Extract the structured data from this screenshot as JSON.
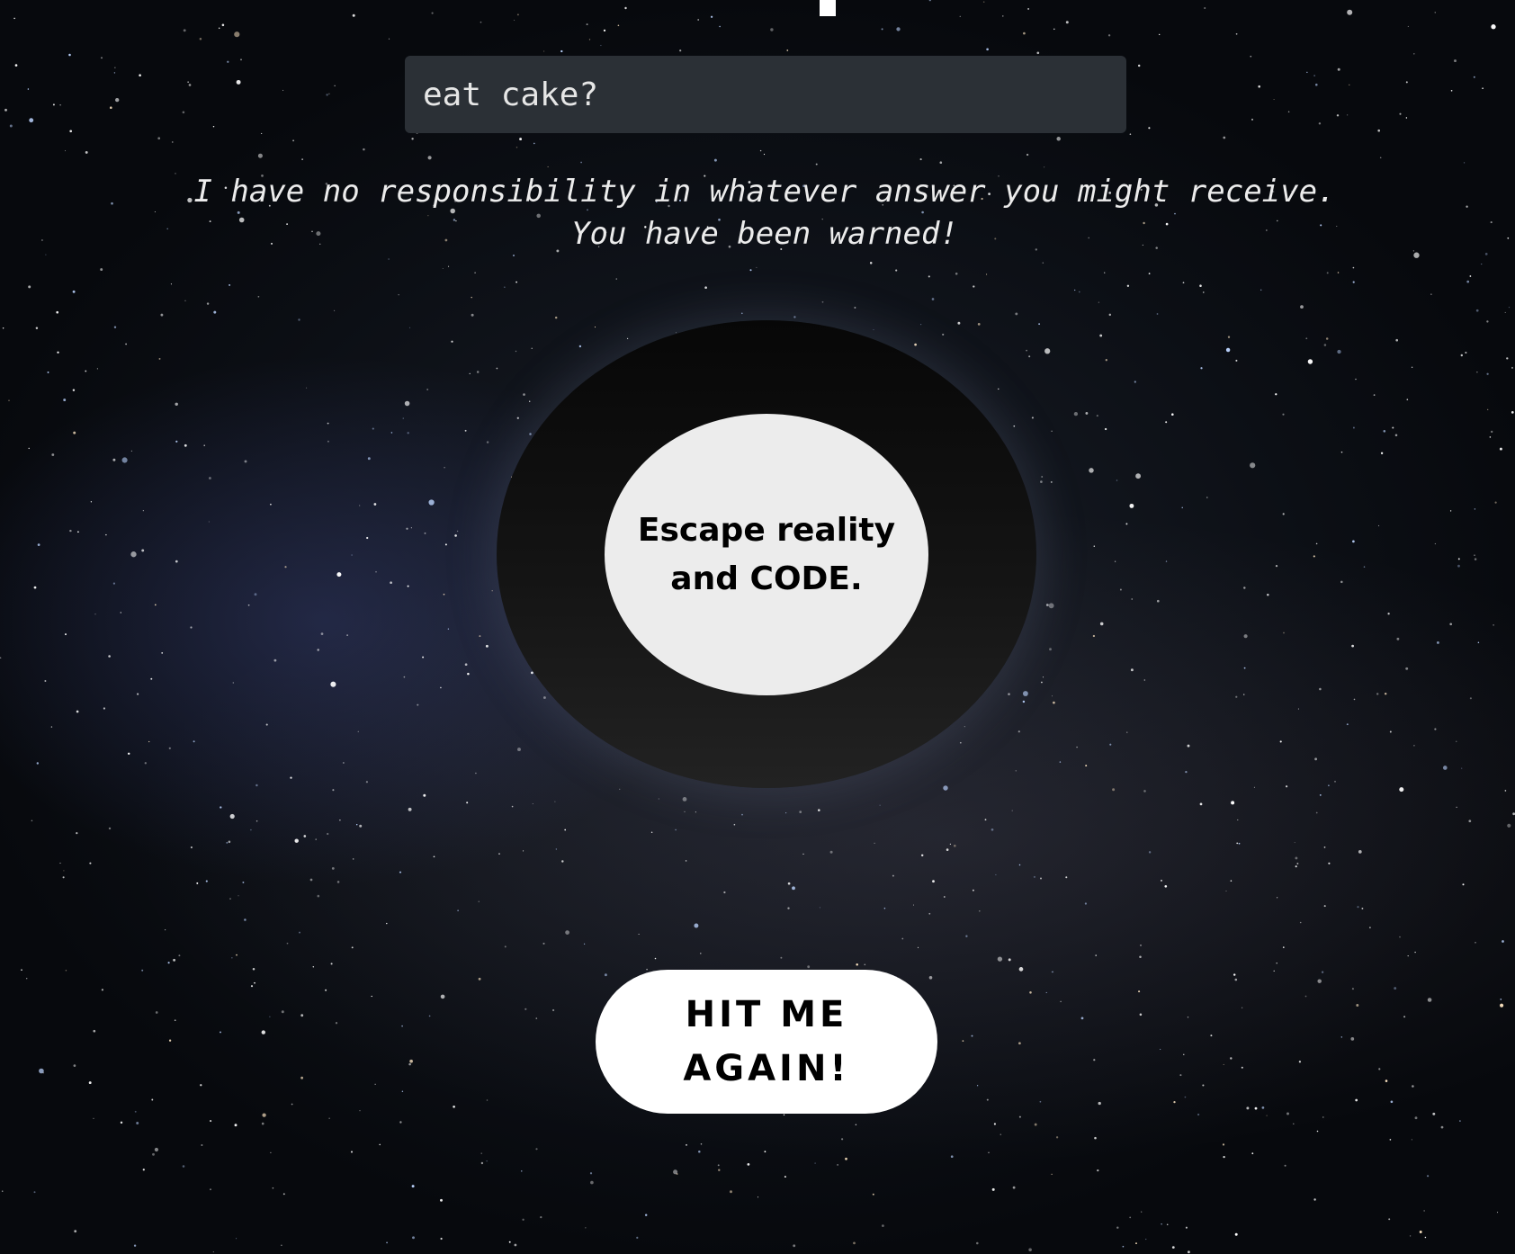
{
  "question": {
    "value": "eat cake?",
    "placeholder": ""
  },
  "disclaimer": {
    "line1": "I have no responsibility in whatever answer you might receive.",
    "line2": "You have been warned!"
  },
  "magic_ball": {
    "answer": "Escape reality and CODE."
  },
  "actions": {
    "hit_again_label": "HIT ME AGAIN!"
  },
  "colors": {
    "background": "#0c0f15",
    "input_background": "#2b3036",
    "ball_outer": "#141414",
    "ball_inner": "#ececec",
    "button_background": "#ffffff"
  }
}
